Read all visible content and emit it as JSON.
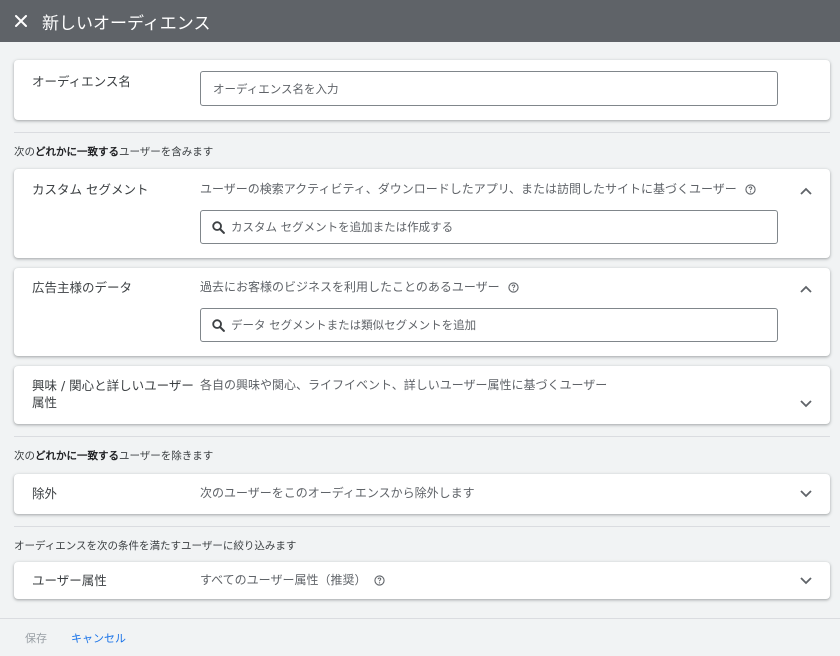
{
  "header": {
    "title": "新しいオーディエンス"
  },
  "audience_name": {
    "label": "オーディエンス名",
    "placeholder": "オーディエンス名を入力"
  },
  "include_section": {
    "prefix": "次の",
    "bold": "どれかに一致する",
    "suffix": "ユーザーを含みます"
  },
  "custom_segment": {
    "label": "カスタム セグメント",
    "description": "ユーザーの検索アクティビティ、ダウンロードしたアプリ、または訪問したサイトに基づくユーザー",
    "search_placeholder": "カスタム セグメントを追加または作成する"
  },
  "advertiser_data": {
    "label": "広告主様のデータ",
    "description": "過去にお客様のビジネスを利用したことのあるユーザー",
    "search_placeholder": "データ セグメントまたは類似セグメントを追加"
  },
  "interests": {
    "label_line1": "興味 / 関心と詳しいユーザー",
    "label_line2": "属性",
    "description": "各自の興味や関心、ライフイベント、詳しいユーザー属性に基づくユーザー"
  },
  "exclude_section": {
    "prefix": "次の",
    "bold": "どれかに一致する",
    "suffix": "ユーザーを除きます"
  },
  "exclusion": {
    "label": "除外",
    "description": "次のユーザーをこのオーディエンスから除外します"
  },
  "narrow_section": {
    "text": "オーディエンスを次の条件を満たすユーザーに絞り込みます"
  },
  "demographics": {
    "label": "ユーザー属性",
    "description": "すべてのユーザー属性（推奨）"
  },
  "footer": {
    "save_label": "保存",
    "cancel_label": "キャンセル"
  }
}
